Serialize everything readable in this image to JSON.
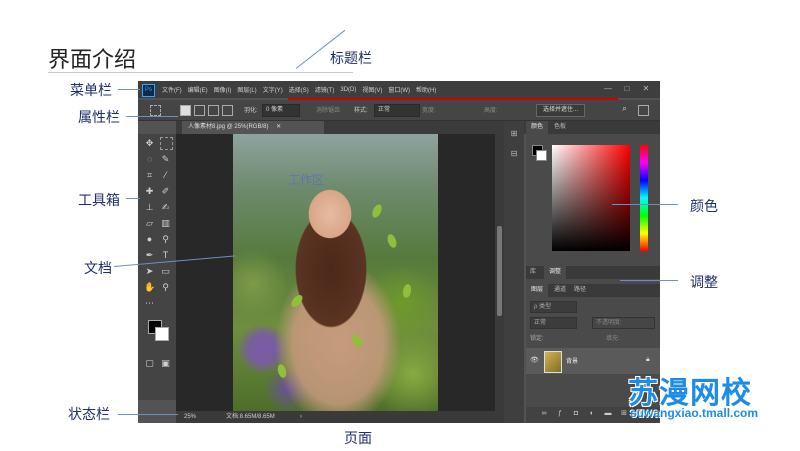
{
  "slide": {
    "title": "界面介绍",
    "callouts": {
      "title_bar": "标题栏",
      "menu_bar": "菜单栏",
      "options_bar": "属性栏",
      "toolbox": "工具箱",
      "document": "文档",
      "status_bar": "状态栏",
      "page": "页面",
      "color": "颜色",
      "adjust": "调整",
      "work_area": "工作区"
    }
  },
  "ps": {
    "logo": "Ps",
    "menu": [
      "文件(F)",
      "编辑(E)",
      "图像(I)",
      "图层(L)",
      "文字(Y)",
      "选择(S)",
      "滤镜(T)",
      "3D(D)",
      "视图(V)",
      "窗口(W)",
      "帮助(H)"
    ],
    "window_buttons": [
      "—",
      "□",
      "✕"
    ],
    "options": {
      "feather_label": "羽化:",
      "feather_value": "0 像素",
      "anti_alias": "消除锯齿",
      "style_label": "样式:",
      "style_value": "正常",
      "width_label": "宽度:",
      "height_label": "高度:",
      "select_mask": "选择并遮住..."
    },
    "doc_tab": "人像素材8.jpg @ 25%(RGB/8)",
    "doc_tab_close": "✕",
    "status": {
      "zoom": "25%",
      "doc_info": "文档:8.65M/8.65M",
      "arrow": "›"
    },
    "panels": {
      "color_tabs": [
        "颜色",
        "色板"
      ],
      "adjust_tabs": [
        "库",
        "调整"
      ],
      "layer_tabs": [
        "图层",
        "通道",
        "路径"
      ],
      "kind_label": "ρ 类型",
      "blend_mode": "正常",
      "opacity_label": "不透明度:",
      "lock_label": "锁定:",
      "fill_label": "填充:",
      "layer_name": "背景"
    }
  },
  "watermark": {
    "name": "苏漫网校",
    "url": "suwangxiao.tmall.com"
  }
}
